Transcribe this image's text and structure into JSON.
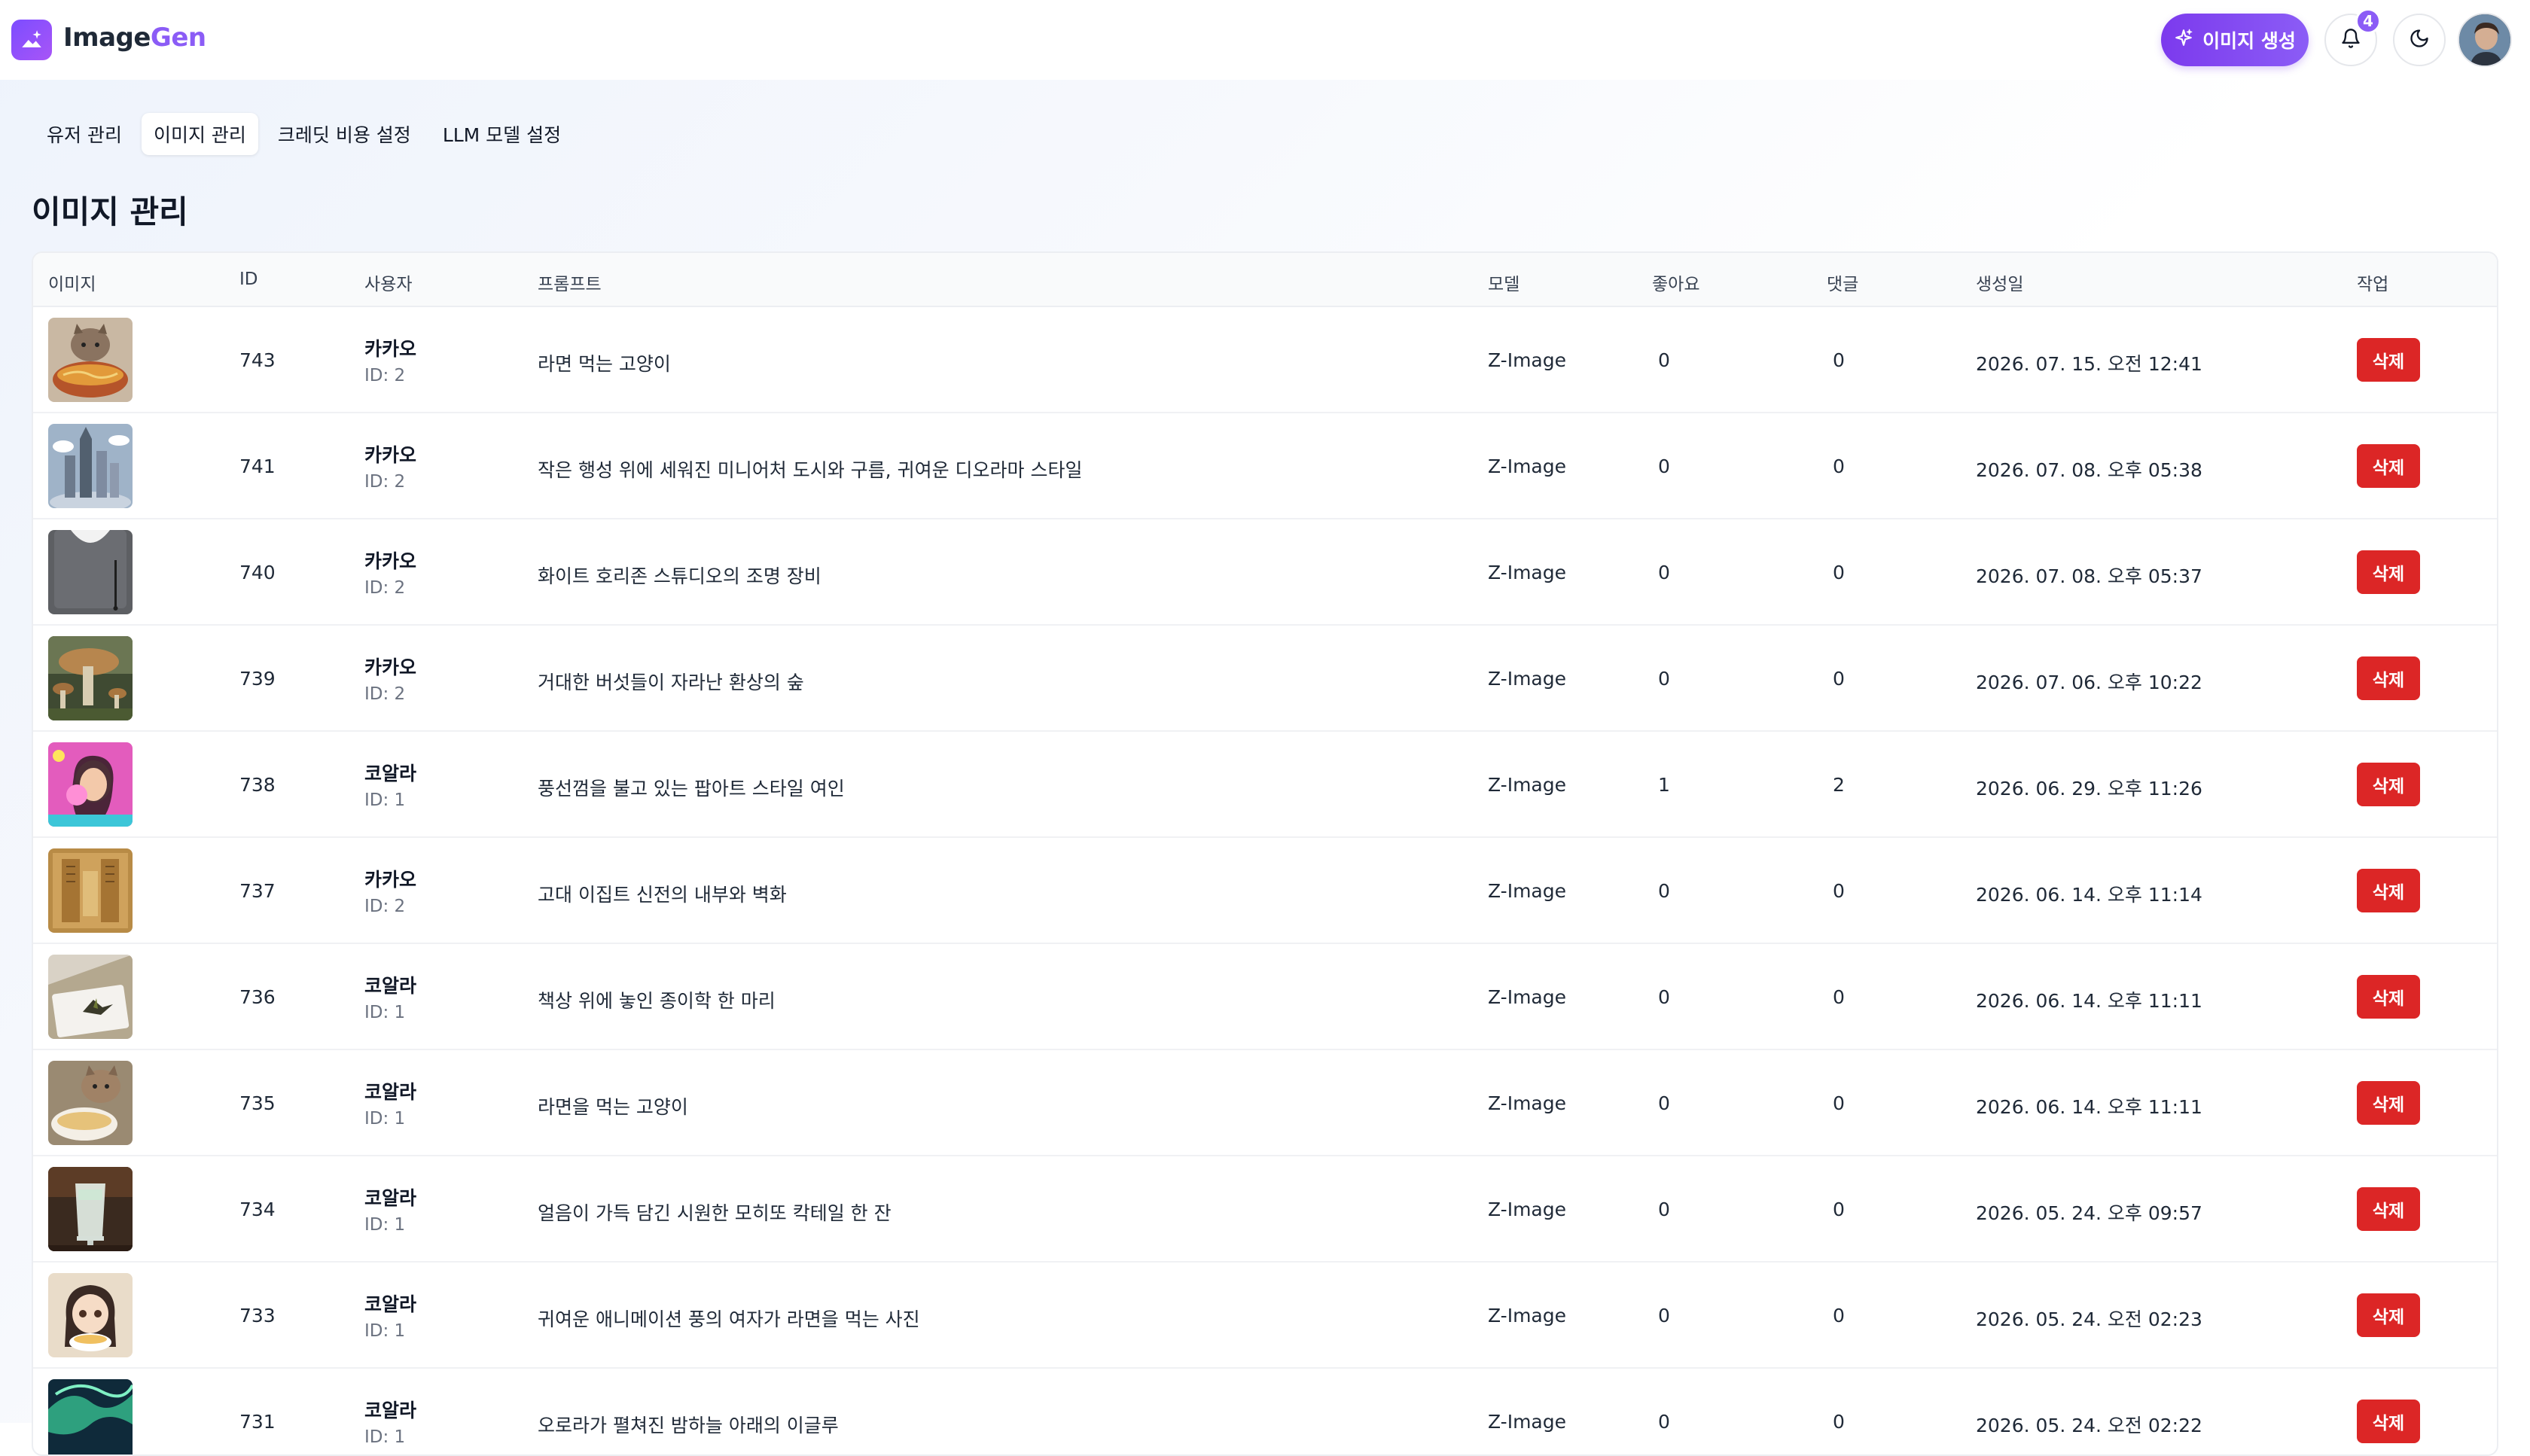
{
  "app": {
    "logo_prefix": "Image",
    "logo_suffix": "Gen",
    "generate_label": "이미지 생성",
    "notification_count": "4",
    "brand_color": "#8b5cf6",
    "danger_color": "#dc2626"
  },
  "tabs": [
    {
      "label": "유저 관리",
      "active": false
    },
    {
      "label": "이미지 관리",
      "active": true
    },
    {
      "label": "크레딧 비용 설정",
      "active": false
    },
    {
      "label": "LLM 모델 설정",
      "active": false
    }
  ],
  "page_title": "이미지 관리",
  "table": {
    "headers": {
      "image": "이미지",
      "id": "ID",
      "user": "사용자",
      "prompt": "프롬프트",
      "model": "모델",
      "likes": "좋아요",
      "comments": "댓글",
      "created": "생성일",
      "action": "작업"
    },
    "delete_label": "삭제",
    "rows": [
      {
        "id": "743",
        "user": "카카오",
        "user_id": "ID: 2",
        "prompt": "라면 먹는 고양이",
        "model": "Z-Image",
        "likes": "0",
        "comments": "0",
        "created": "2026. 07. 15. 오전 12:41",
        "thumb": "cat-ramen"
      },
      {
        "id": "741",
        "user": "카카오",
        "user_id": "ID: 2",
        "prompt": "작은 행성 위에 세워진 미니어처 도시와 구름, 귀여운 디오라마 스타일",
        "model": "Z-Image",
        "likes": "0",
        "comments": "0",
        "created": "2026. 07. 08. 오후 05:38",
        "thumb": "mini-city"
      },
      {
        "id": "740",
        "user": "카카오",
        "user_id": "ID: 2",
        "prompt": "화이트 호리존 스튜디오의 조명 장비",
        "model": "Z-Image",
        "likes": "0",
        "comments": "0",
        "created": "2026. 07. 08. 오후 05:37",
        "thumb": "studio-light"
      },
      {
        "id": "739",
        "user": "카카오",
        "user_id": "ID: 2",
        "prompt": "거대한 버섯들이 자라난 환상의 숲",
        "model": "Z-Image",
        "likes": "0",
        "comments": "0",
        "created": "2026. 07. 06. 오후 10:22",
        "thumb": "mushroom-forest"
      },
      {
        "id": "738",
        "user": "코알라",
        "user_id": "ID: 1",
        "prompt": "풍선껌을 불고 있는 팝아트 스타일 여인",
        "model": "Z-Image",
        "likes": "1",
        "comments": "2",
        "created": "2026. 06. 29. 오후 11:26",
        "thumb": "popart-woman"
      },
      {
        "id": "737",
        "user": "카카오",
        "user_id": "ID: 2",
        "prompt": "고대 이집트 신전의 내부와 벽화",
        "model": "Z-Image",
        "likes": "0",
        "comments": "0",
        "created": "2026. 06. 14. 오후 11:14",
        "thumb": "egypt-temple"
      },
      {
        "id": "736",
        "user": "코알라",
        "user_id": "ID: 1",
        "prompt": "책상 위에 놓인 종이학 한 마리",
        "model": "Z-Image",
        "likes": "0",
        "comments": "0",
        "created": "2026. 06. 14. 오후 11:11",
        "thumb": "paper-crane"
      },
      {
        "id": "735",
        "user": "코알라",
        "user_id": "ID: 1",
        "prompt": "라면을 먹는 고양이",
        "model": "Z-Image",
        "likes": "0",
        "comments": "0",
        "created": "2026. 06. 14. 오후 11:11",
        "thumb": "cat-ramen-2"
      },
      {
        "id": "734",
        "user": "코알라",
        "user_id": "ID: 1",
        "prompt": "얼음이 가득 담긴 시원한 모히또 칵테일 한 잔",
        "model": "Z-Image",
        "likes": "0",
        "comments": "0",
        "created": "2026. 05. 24. 오후 09:57",
        "thumb": "mojito"
      },
      {
        "id": "733",
        "user": "코알라",
        "user_id": "ID: 1",
        "prompt": "귀여운 애니메이션 풍의 여자가 라면을 먹는 사진",
        "model": "Z-Image",
        "likes": "0",
        "comments": "0",
        "created": "2026. 05. 24. 오전 02:23",
        "thumb": "anime-girl"
      },
      {
        "id": "731",
        "user": "코알라",
        "user_id": "ID: 1",
        "prompt": "오로라가 펼쳐진 밤하늘 아래의 이글루",
        "model": "Z-Image",
        "likes": "0",
        "comments": "0",
        "created": "2026. 05. 24. 오전 02:22",
        "thumb": "aurora"
      }
    ]
  }
}
